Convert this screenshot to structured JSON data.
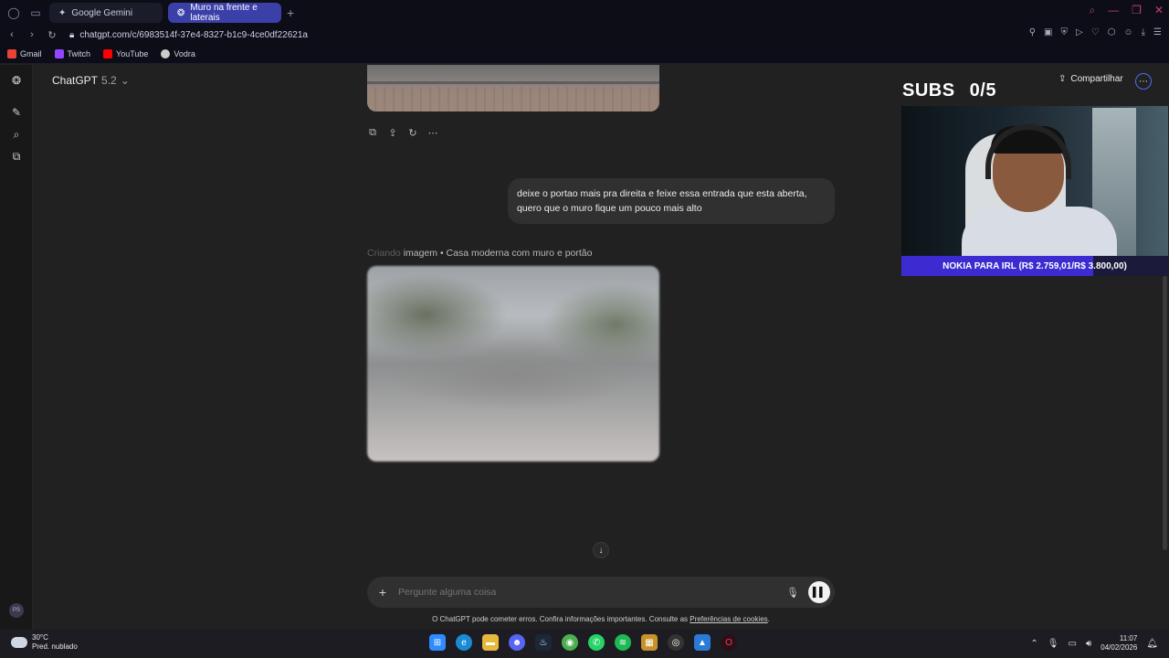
{
  "browser": {
    "tabs": [
      {
        "label": "Google Gemini",
        "icon": "gemini-icon",
        "active": false
      },
      {
        "label": "Muro na frente e laterais",
        "icon": "chatgpt-icon",
        "active": true
      }
    ],
    "url": "chatgpt.com/c/6983514f-37e4-8327-b1c9-4ce0df22621a",
    "bookmarks": [
      {
        "label": "Gmail",
        "icon": "gmail-icon",
        "color": "#ea4335"
      },
      {
        "label": "Twitch",
        "icon": "twitch-icon",
        "color": "#9146ff"
      },
      {
        "label": "YouTube",
        "icon": "youtube-icon",
        "color": "#ff0000"
      },
      {
        "label": "Vodra",
        "icon": "vodra-icon",
        "color": "#cccccc"
      }
    ]
  },
  "chat": {
    "model_name": "ChatGPT",
    "model_version": "5.2",
    "share_label": "Compartilhar",
    "user_message": "deixe o portao mais pra direita e feixe essa entrada que esta aberta, quero que o muro fique um pouco mais alto",
    "status_prefix": "Criando",
    "status_suffix": "imagem • Casa moderna com muro e portão",
    "composer_placeholder": "Pergunte alguma coisa",
    "disclaimer_text": "O ChatGPT pode cometer erros. Confira informações importantes. Consulte as ",
    "disclaimer_link": "Preferências de cookies",
    "disclaimer_end": ".",
    "avatar_initials": "PS"
  },
  "overlay": {
    "subs_label": "SUBS",
    "subs_count": "0/5",
    "goal_text": "NOKIA PARA IRL (R$ 2.759,01/R$ 3.800,00)"
  },
  "taskbar": {
    "temperature": "30°C",
    "weather": "Pred. nublado",
    "time": "11:07",
    "date": "04/02/2026"
  }
}
